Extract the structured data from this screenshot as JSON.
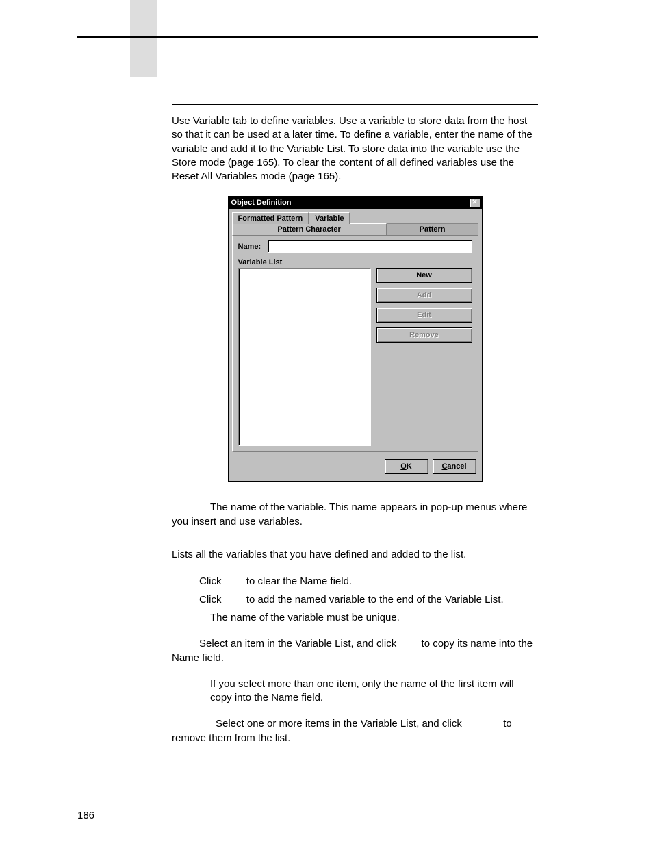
{
  "intro": "Use Variable tab to define variables. Use a variable to store data from the host so that it can be used at a later time. To define a variable, enter the name of the variable and add it to the Variable List. To store data into the variable use the Store mode (page 165). To clear the content of all defined variables use the Reset All Variables mode (page 165).",
  "dialog": {
    "title": "Object Definition",
    "tabs": {
      "formatted_pattern": "Formatted Pattern",
      "variable": "Variable"
    },
    "sub_tabs": {
      "pattern_character": "Pattern Character",
      "pattern": "Pattern"
    },
    "name_label": "Name:",
    "name_value": "",
    "varlist_label": "Variable List",
    "buttons": {
      "new": "New",
      "add": "Add",
      "edit": "Edit",
      "remove": "Remove"
    },
    "footer": {
      "ok": "OK",
      "cancel": "Cancel"
    }
  },
  "defs": {
    "name_pre": "The name of the variable. This name appears in pop-up menus where you insert and use variables.",
    "varlist_intro": "Lists all the variables that you have defined and added to the list.",
    "new_l1": "Click ",
    "new_l2": " to clear the Name field.",
    "add_l1": "Click ",
    "add_l2": " to add the named variable to the end of the Variable List.",
    "add_note": "The name of the variable must be unique.",
    "edit_l1": "Select an item in the Variable List, and click ",
    "edit_l2": " to copy its name into the Name field.",
    "edit_note": "If you select more than one item, only the name of the first item will copy into the Name field.",
    "remove_l1": "Select one or more items in the Variable List, and click ",
    "remove_l2": " to remove them from the list."
  },
  "page_number": "186"
}
